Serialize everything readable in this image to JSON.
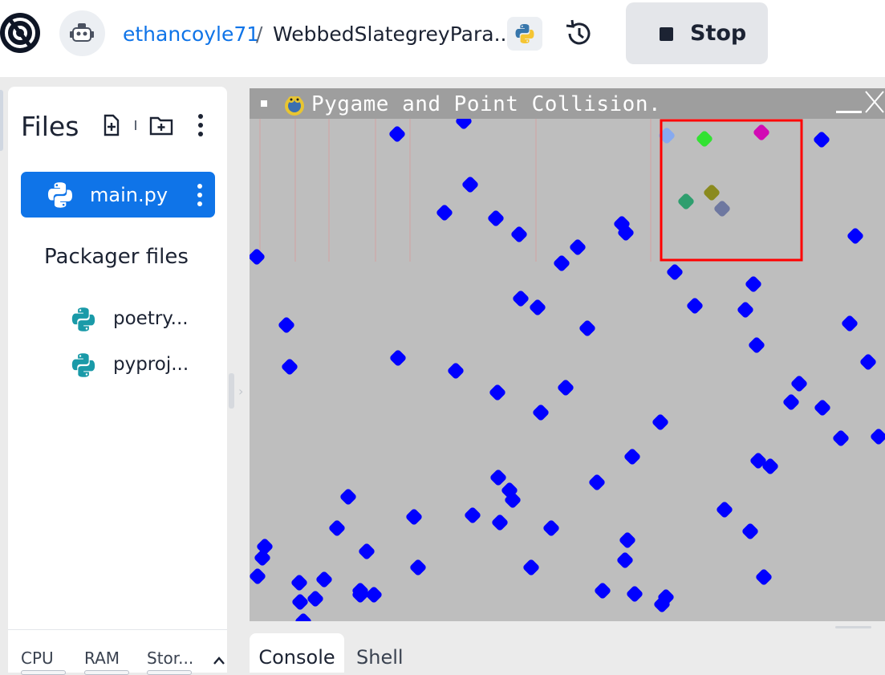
{
  "header": {
    "username": "ethancoyle71",
    "separator": "/",
    "repl_name": "WebbedSlategreyPara...",
    "stop_label": "Stop",
    "language_icon": "python-icon",
    "history_icon": "history-icon"
  },
  "files": {
    "title": "Files",
    "active_file": "main.py",
    "packager_title": "Packager files",
    "packager_items": [
      "poetry...",
      "pyproj..."
    ]
  },
  "resources": {
    "cpu_label": "CPU",
    "ram_label": "RAM",
    "storage_label": "Stor..."
  },
  "pygame": {
    "window_title": "Pygame and Point Collision.",
    "background_color": "#bebebe",
    "titlebar_color": "#9e9e9e",
    "point_color": "#0000ff",
    "rect_color": "#ff0000",
    "points_in_rect_colors": [
      "#87aaf0",
      "#32e232",
      "#d20ab4",
      "#2e9e6e",
      "#8a8a1e",
      "#6e78a0"
    ]
  },
  "bottom_tabs": {
    "console_label": "Console",
    "shell_label": "Shell",
    "active": "Console"
  }
}
